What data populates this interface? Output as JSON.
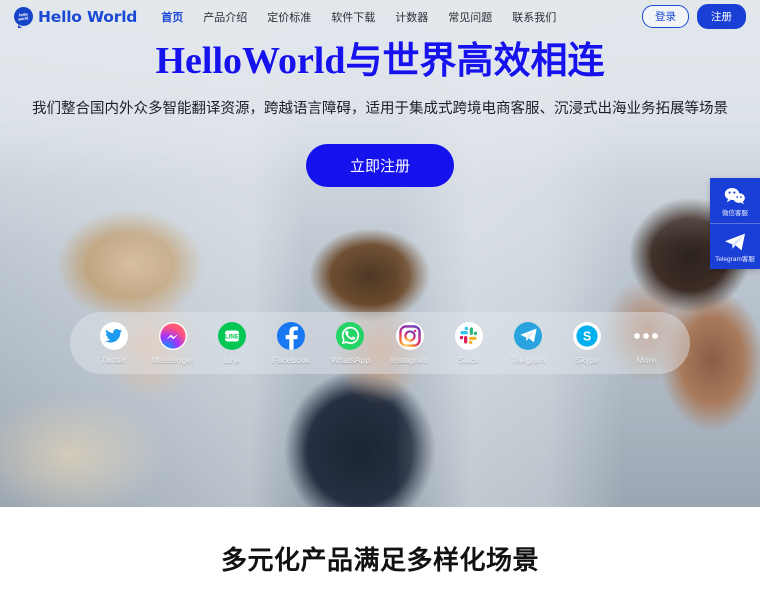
{
  "navbar": {
    "brand_mark_line1": "hello",
    "brand_mark_line2": "world",
    "brand_name": "Hello World",
    "links": [
      {
        "label": "首页",
        "active": true
      },
      {
        "label": "产品介绍",
        "active": false
      },
      {
        "label": "定价标准",
        "active": false
      },
      {
        "label": "软件下载",
        "active": false
      },
      {
        "label": "计数器",
        "active": false
      },
      {
        "label": "常见问题",
        "active": false
      },
      {
        "label": "联系我们",
        "active": false
      }
    ],
    "login_label": "登录",
    "register_label": "注册"
  },
  "hero": {
    "title_en": "HelloWorld",
    "title_cn": "与世界高效相连",
    "subtitle": "我们整合国内外众多智能翻译资源，跨越语言障碍，适用于集成式跨境电商客服、沉浸式出海业务拓展等场景",
    "cta_label": "立即注册"
  },
  "side_widget": {
    "items": [
      {
        "icon": "wechat-icon",
        "label": "微信客服"
      },
      {
        "icon": "telegram-icon",
        "label": "Telegram客服"
      }
    ]
  },
  "social_bar": {
    "items": [
      {
        "icon": "twitter-icon",
        "label": "Twitter"
      },
      {
        "icon": "messenger-icon",
        "label": "Messenger"
      },
      {
        "icon": "line-icon",
        "label": "Line"
      },
      {
        "icon": "facebook-icon",
        "label": "Facebook"
      },
      {
        "icon": "whatsapp-icon",
        "label": "WhatsApp"
      },
      {
        "icon": "instagram-icon",
        "label": "Instagram"
      },
      {
        "icon": "slack-icon",
        "label": "Slack"
      },
      {
        "icon": "telegram-icon",
        "label": "Telegram"
      },
      {
        "icon": "skype-icon",
        "label": "Skype"
      },
      {
        "icon": "more-dots-icon",
        "label": "More"
      }
    ]
  },
  "section": {
    "title": "多元化产品满足多样化场景"
  },
  "colors": {
    "brand_blue": "#1a49d6",
    "hero_blue": "#1512ee",
    "widget_blue": "#1a3fd6",
    "section_title": "#121212"
  }
}
